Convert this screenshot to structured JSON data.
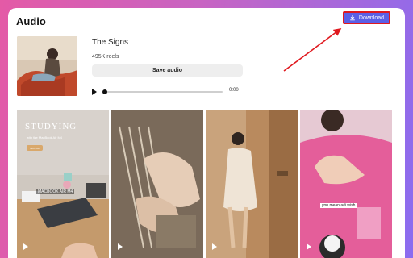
{
  "header": {
    "title": "Audio",
    "download_label": "Download"
  },
  "track": {
    "name": "The Signs",
    "reels": "495K reels",
    "save_label": "Save audio",
    "time": "0:00",
    "progress": 0
  },
  "tiles": [
    {
      "heading": "STUDYING",
      "subheading": "with the MacBook Air M4",
      "chip": "Let's Go",
      "overlay": "MACBOOK AIR M4"
    },
    {},
    {},
    {
      "caption": "you mean a#i wish"
    }
  ],
  "colors": {
    "download_button": "#5b5fe6",
    "highlight_border": "#e0191f",
    "annotation_arrow": "#e0191f"
  }
}
